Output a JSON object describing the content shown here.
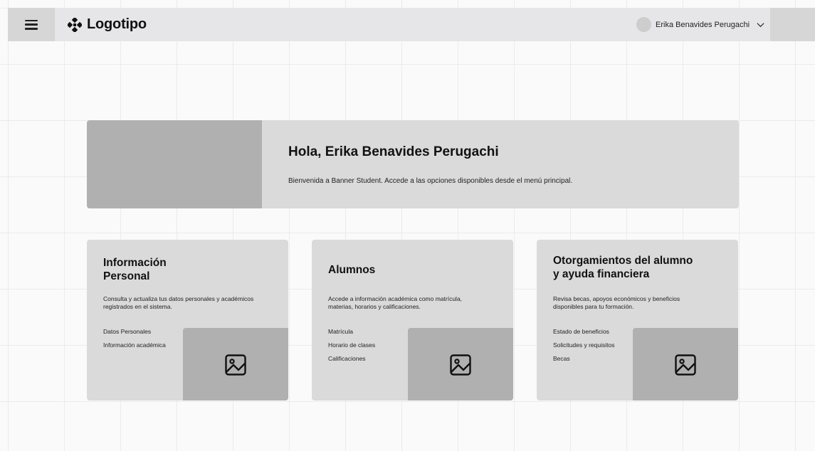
{
  "header": {
    "logo_text": "Logotipo",
    "user_name": "Erika Benavides Perugachi"
  },
  "hero": {
    "title": "Hola, Erika Benavides Perugachi",
    "subtitle": "Bienvenida a Banner Student. Accede a las opciones disponibles desde el menú principal."
  },
  "cards": [
    {
      "title_line1": "Información",
      "title_line2": "Personal",
      "description": "Consulta y actualiza tus datos personales y académicos registrados en el sistema.",
      "links": [
        "Datos Personales",
        "Información académica"
      ]
    },
    {
      "title_line1": "Alumnos",
      "title_line2": "",
      "description": "Accede a información académica como matrícula, materias, horarios y calificaciones.",
      "links": [
        "Matrícula",
        "Horario de clases",
        "Calificaciones"
      ]
    },
    {
      "title_line1": "Otorgamientos del alumno",
      "title_line2": "y ayuda financiera",
      "description": "Revisa becas, apoyos económicos y beneficios disponibles para tu formación.",
      "links": [
        "Estado de beneficios",
        "Solicitudes y requisitos",
        "Becas"
      ]
    }
  ],
  "icons": {
    "menu": "hamburger-menu-icon",
    "logo": "logo-mark-icon",
    "user_dropdown": "chevron-down-icon",
    "card_image": "image-placeholder-icon"
  },
  "colors": {
    "placeholder_dark": "#b0b0b0",
    "card_background": "#dadada",
    "topbar_background": "#e6e6e9"
  }
}
